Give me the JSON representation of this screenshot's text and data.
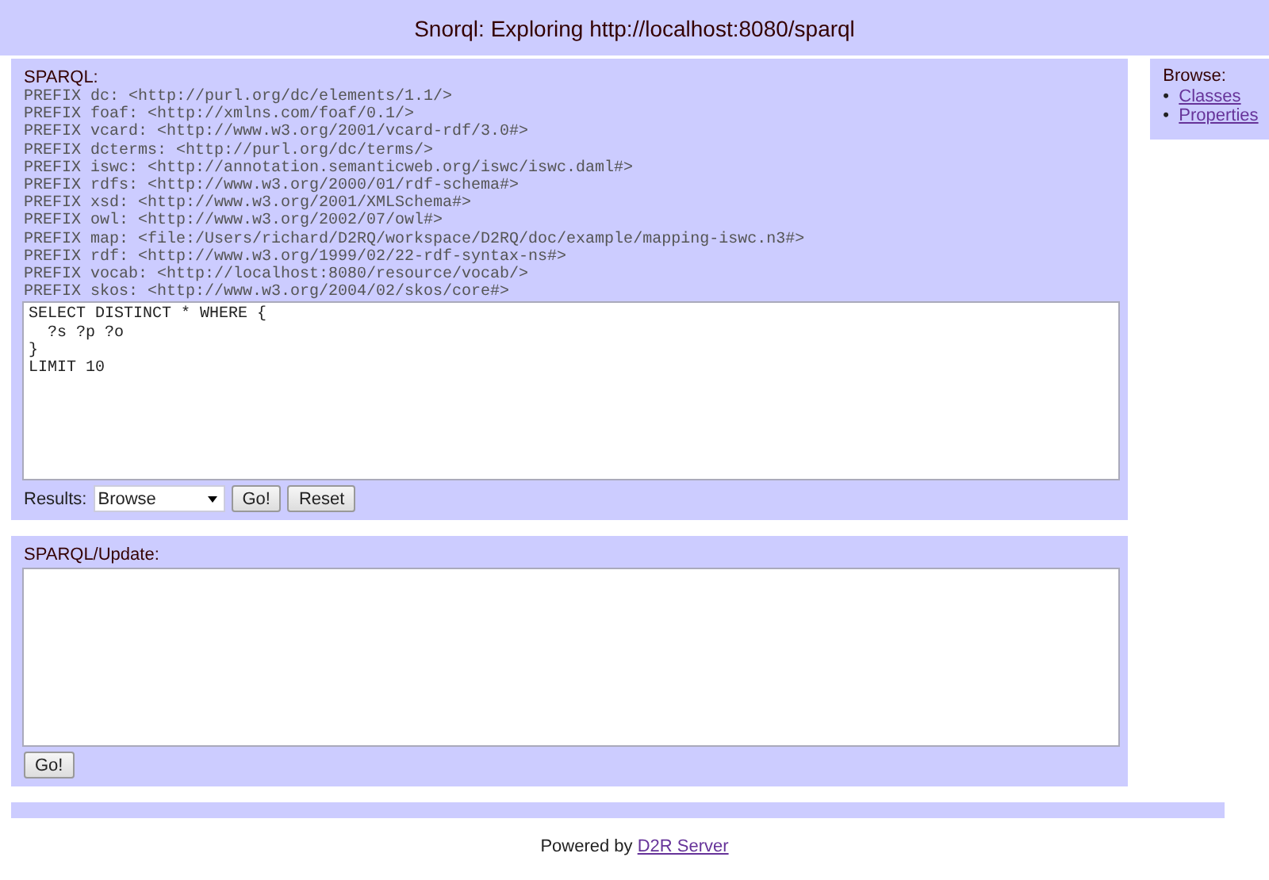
{
  "header": {
    "title": "Snorql: Exploring http://localhost:8080/sparql"
  },
  "sparql": {
    "label": "SPARQL:",
    "prefixes": [
      "PREFIX dc: <http://purl.org/dc/elements/1.1/>",
      "PREFIX foaf: <http://xmlns.com/foaf/0.1/>",
      "PREFIX vcard: <http://www.w3.org/2001/vcard-rdf/3.0#>",
      "PREFIX dcterms: <http://purl.org/dc/terms/>",
      "PREFIX iswc: <http://annotation.semanticweb.org/iswc/iswc.daml#>",
      "PREFIX rdfs: <http://www.w3.org/2000/01/rdf-schema#>",
      "PREFIX xsd: <http://www.w3.org/2001/XMLSchema#>",
      "PREFIX owl: <http://www.w3.org/2002/07/owl#>",
      "PREFIX map: <file:/Users/richard/D2RQ/workspace/D2RQ/doc/example/mapping-iswc.n3#>",
      "PREFIX rdf: <http://www.w3.org/1999/02/22-rdf-syntax-ns#>",
      "PREFIX vocab: <http://localhost:8080/resource/vocab/>",
      "PREFIX skos: <http://www.w3.org/2004/02/skos/core#>"
    ],
    "query": "SELECT DISTINCT * WHERE {\n  ?s ?p ?o\n}\nLIMIT 10",
    "results_label": "Results:",
    "results_value": "Browse",
    "buttons": [
      "Go!",
      "Reset"
    ]
  },
  "update": {
    "label": "SPARQL/Update:",
    "buttons": [
      "Go!"
    ]
  },
  "browse": {
    "label": "Browse:",
    "links": [
      {
        "marker": "•",
        "label": "Classes"
      },
      {
        "marker": "•",
        "label": "Properties"
      }
    ]
  },
  "footer": {
    "text": "Powered by",
    "link": "D2R Server"
  }
}
